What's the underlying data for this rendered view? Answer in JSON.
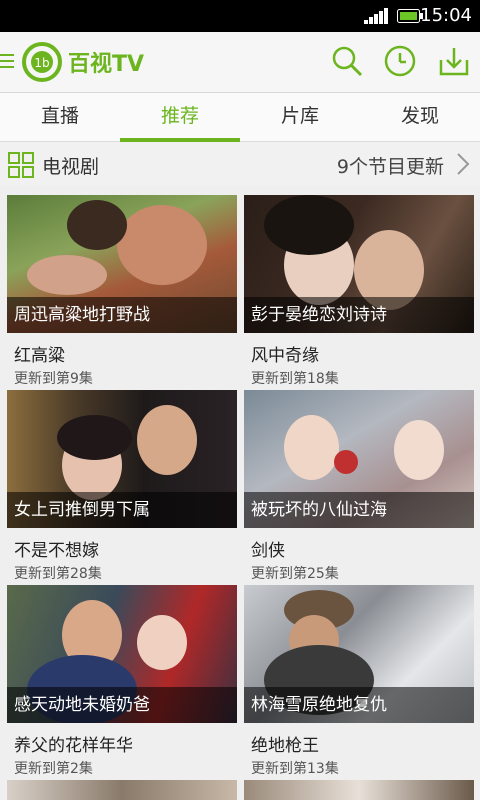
{
  "status_bar": {
    "time": "15:04"
  },
  "app": {
    "name": "百视TV"
  },
  "tabs": [
    {
      "label": "直播"
    },
    {
      "label": "推荐"
    },
    {
      "label": "片库"
    },
    {
      "label": "发现"
    }
  ],
  "active_tab": "推荐",
  "section": {
    "title": "电视剧",
    "update_text": "9个节目更新"
  },
  "shows": [
    {
      "overlay": "周迅高粱地打野战",
      "title": "红高粱",
      "episode": "更新到第9集"
    },
    {
      "overlay": "彭于晏绝恋刘诗诗",
      "title": "风中奇缘",
      "episode": "更新到第18集"
    },
    {
      "overlay": "女上司推倒男下属",
      "title": "不是不想嫁",
      "episode": "更新到第28集"
    },
    {
      "overlay": "被玩坏的八仙过海",
      "title": "剑侠",
      "episode": "更新到第25集"
    },
    {
      "overlay": "感天动地未婚奶爸",
      "title": "养父的花样年华",
      "episode": "更新到第2集"
    },
    {
      "overlay": "林海雪原绝地复仇",
      "title": "绝地枪王",
      "episode": "更新到第13集"
    }
  ],
  "colors": {
    "accent": "#6cb51f",
    "status_bar": "#000000"
  },
  "icons": [
    "menu-icon",
    "logo-icon",
    "search-icon",
    "history-icon",
    "download-icon",
    "grid-icon",
    "chevron-right-icon"
  ]
}
